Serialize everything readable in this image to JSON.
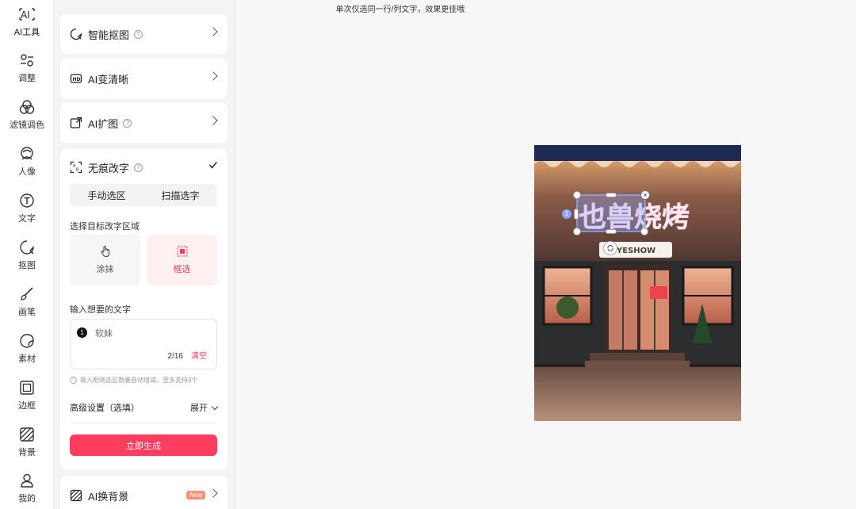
{
  "rail": [
    {
      "icon": "ai-tools-icon",
      "label": "AI工具"
    },
    {
      "icon": "adjust-icon",
      "label": "调整"
    },
    {
      "icon": "filter-icon",
      "label": "滤镜调色"
    },
    {
      "icon": "portrait-icon",
      "label": "人像"
    },
    {
      "icon": "text-icon",
      "label": "文字"
    },
    {
      "icon": "cutout-icon",
      "label": "抠图"
    },
    {
      "icon": "brush-icon",
      "label": "画笔"
    },
    {
      "icon": "material-icon",
      "label": "素材"
    },
    {
      "icon": "frame-icon",
      "label": "边框"
    },
    {
      "icon": "background-icon",
      "label": "背景"
    },
    {
      "icon": "profile-icon",
      "label": "我的"
    }
  ],
  "tools": {
    "smart_cutout": "智能抠图",
    "ai_sharpen": "AI变清晰",
    "ai_expand": "AI扩图",
    "erase_text": "无痕改字",
    "ai_bg": "AI换背景",
    "new_badge": "New"
  },
  "erase_text": {
    "tabs": [
      "手动选区",
      "扫描选字"
    ],
    "select_label": "选择目标改字区域",
    "modes": [
      "涂抹",
      "框选"
    ],
    "input_label": "输入想要的文字",
    "item_index": "1",
    "item_text": "软妹",
    "count": "2/16",
    "clear": "清空",
    "hint": "输入框随选区数量自动增减，至多支持3个",
    "advanced": "高级设置（选填）",
    "expand": "展开",
    "generate": "立即生成"
  },
  "canvas": {
    "tip": "单次仅选同一行/列文字，效果更佳哦"
  },
  "photo": {
    "sign_text": "也兽烧烤",
    "small_sign": "YESHOW"
  },
  "colors": {
    "accent": "#ff3d5e",
    "selection": "#8aa6ff"
  }
}
